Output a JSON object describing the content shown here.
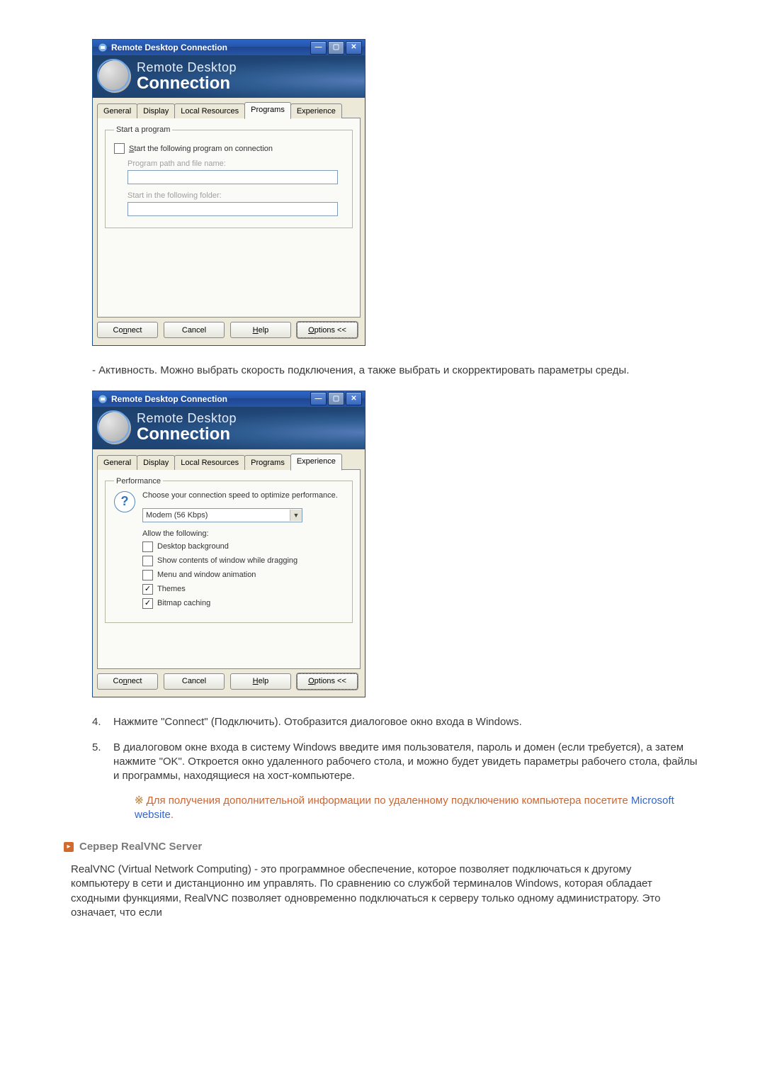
{
  "rdc_window": {
    "title": "Remote Desktop Connection",
    "brand_top": "Remote Desktop",
    "brand_bottom": "Connection",
    "tabs": [
      "General",
      "Display",
      "Local Resources",
      "Programs",
      "Experience"
    ],
    "buttons": {
      "connect": "Connect",
      "cancel": "Cancel",
      "help": "Help",
      "options": "Options <<"
    }
  },
  "programs_panel": {
    "fieldset_legend": "Start a program",
    "checkbox_label": "Start the following program on connection",
    "path_label": "Program path and file name:",
    "folder_label": "Start in the following folder:"
  },
  "experience_panel": {
    "fieldset_legend": "Performance",
    "instruction": "Choose your connection speed to optimize performance.",
    "dropdown_value": "Modem (56 Kbps)",
    "allow_label": "Allow the following:",
    "options": [
      {
        "label": "Desktop background",
        "checked": false
      },
      {
        "label": "Show contents of window while dragging",
        "checked": false
      },
      {
        "label": "Menu and window animation",
        "checked": false
      },
      {
        "label": "Themes",
        "checked": true
      },
      {
        "label": "Bitmap caching",
        "checked": true
      }
    ]
  },
  "para_experience": "- Активность. Можно выбрать скорость подключения, а также выбрать и скорректировать параметры среды.",
  "steps": {
    "item4": "Нажмите \"Connect\" (Подключить). Отобразится диалоговое окно входа в Windows.",
    "item5": "В диалоговом окне входа в систему Windows введите имя пользователя, пароль и домен (если требуется), а затем нажмите \"OK\". Откроется окно удаленного рабочего стола, и можно будет увидеть параметры рабочего стола, файлы и программы, находящиеся на хост-компьютере."
  },
  "note": {
    "prefix": "Для получения дополнительной информации по удаленному подключению компьютера посетите ",
    "link_text": "Microsoft website",
    "suffix": "."
  },
  "section2": {
    "title": "Сервер RealVNC Server",
    "body": "RealVNC (Virtual Network Computing) - это программное обеспечение, которое позволяет подключаться к другому компьютеру в сети и дистанционно им управлять. По сравнению со службой терминалов Windows, которая обладает сходными функциями, RealVNC позволяет одновременно подключаться к серверу только одному администратору. Это означает, что если"
  }
}
